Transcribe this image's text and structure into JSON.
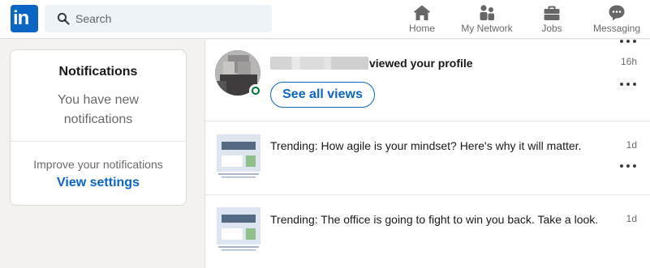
{
  "topbar": {
    "logo_text": "in",
    "search": {
      "placeholder": "Search",
      "value": ""
    },
    "nav": [
      {
        "label": "Home",
        "icon": "home-icon"
      },
      {
        "label": "My Network",
        "icon": "people-icon"
      },
      {
        "label": "Jobs",
        "icon": "briefcase-icon"
      },
      {
        "label": "Messaging",
        "icon": "message-icon"
      }
    ]
  },
  "left_card": {
    "title": "Notifications",
    "subtitle": "You have new notifications",
    "improve_text": "Improve your notifications",
    "settings_link": "View settings"
  },
  "notifications": [
    {
      "type": "profile_view",
      "text": "viewed your profile",
      "button": "See all views",
      "time": "16h",
      "online": true
    },
    {
      "type": "trending",
      "text": "Trending: How agile is your mindset? Here's why it will matter.",
      "time": "1d"
    },
    {
      "type": "trending",
      "text": "Trending: The office is going to fight to win you back. Take a look.",
      "time": "1d"
    }
  ],
  "colors": {
    "brand": "#0a66c2",
    "online": "#057642",
    "background": "#f3f2ef"
  }
}
